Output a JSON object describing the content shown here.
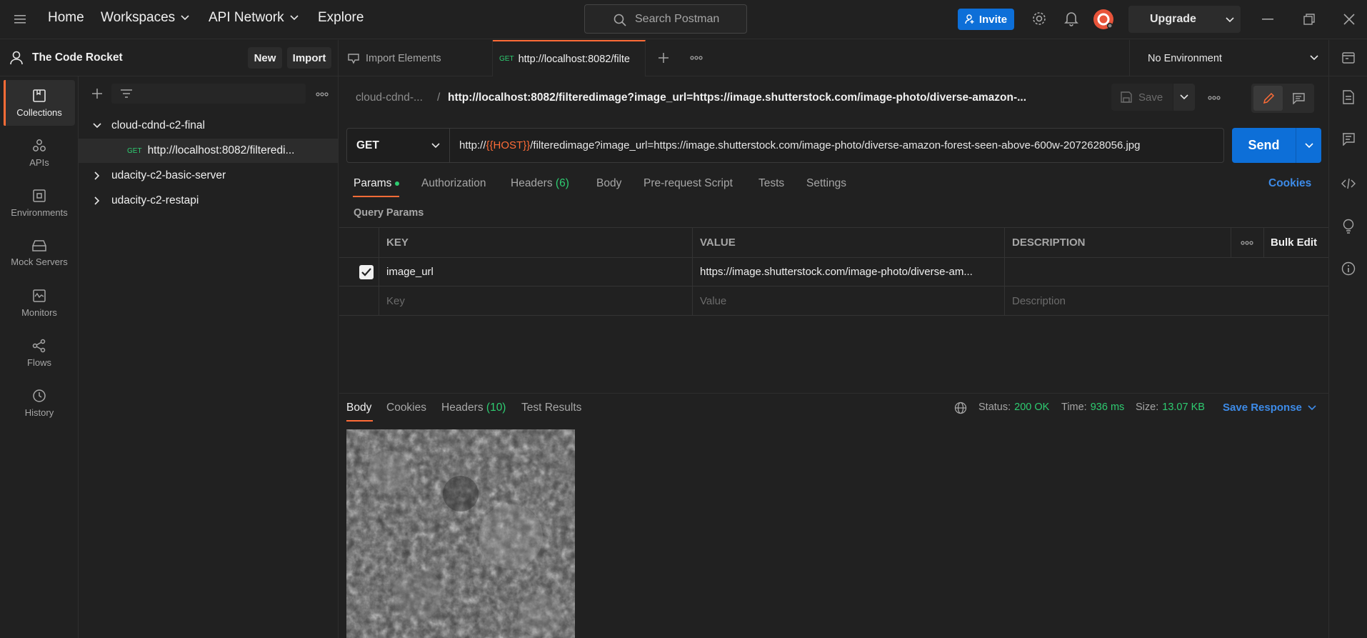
{
  "topbar": {
    "home": "Home",
    "workspaces": "Workspaces",
    "api_network": "API Network",
    "explore": "Explore",
    "search_placeholder": "Search Postman",
    "invite": "Invite",
    "upgrade": "Upgrade"
  },
  "workspace": {
    "name": "The Code Rocket",
    "new_label": "New",
    "import_label": "Import"
  },
  "rail": {
    "items": [
      {
        "label": "Collections",
        "icon": "collections-icon"
      },
      {
        "label": "APIs",
        "icon": "apis-icon"
      },
      {
        "label": "Environments",
        "icon": "environments-icon"
      },
      {
        "label": "Mock Servers",
        "icon": "mock-servers-icon"
      },
      {
        "label": "Monitors",
        "icon": "monitors-icon"
      },
      {
        "label": "Flows",
        "icon": "flows-icon"
      },
      {
        "label": "History",
        "icon": "history-icon"
      }
    ]
  },
  "collections": {
    "tree": [
      {
        "label": "cloud-cdnd-c2-final"
      },
      {
        "method": "GET",
        "label": "http://localhost:8082/filteredi..."
      },
      {
        "label": "udacity-c2-basic-server"
      },
      {
        "label": "udacity-c2-restapi"
      }
    ]
  },
  "tabs": {
    "import_elements": "Import Elements",
    "active_method": "GET",
    "active_label": "http://localhost:8082/filte",
    "environment": "No Environment"
  },
  "request": {
    "breadcrumb_collection": "cloud-cdnd-...",
    "breadcrumb_sep": "/",
    "breadcrumb_title": "http://localhost:8082/filteredimage?image_url=https://image.shutterstock.com/image-photo/diverse-amazon-...",
    "save_label": "Save",
    "method": "GET",
    "url_prefix": "http://",
    "url_variable": "{{HOST}}",
    "url_suffix": "/filteredimage?image_url=https://image.shutterstock.com/image-photo/diverse-amazon-forest-seen-above-600w-2072628056.jpg",
    "send_label": "Send",
    "tabs": {
      "params": "Params",
      "authorization": "Authorization",
      "headers": "Headers",
      "headers_count": "(6)",
      "body": "Body",
      "pre_request": "Pre-request Script",
      "tests": "Tests",
      "settings": "Settings",
      "cookies": "Cookies"
    },
    "query_params_title": "Query Params",
    "table": {
      "col_key": "KEY",
      "col_value": "VALUE",
      "col_description": "DESCRIPTION",
      "bulk_edit": "Bulk Edit",
      "row_key": "image_url",
      "row_value": "https://image.shutterstock.com/image-photo/diverse-am...",
      "key_placeholder": "Key",
      "value_placeholder": "Value",
      "description_placeholder": "Description"
    }
  },
  "response": {
    "tabs": {
      "body": "Body",
      "cookies": "Cookies",
      "headers": "Headers",
      "headers_count": "(10)",
      "test_results": "Test Results"
    },
    "status_label": "Status:",
    "status_value": "200 OK",
    "time_label": "Time:",
    "time_value": "936 ms",
    "size_label": "Size:",
    "size_value": "13.07 KB",
    "save_response": "Save Response"
  },
  "colors": {
    "accent": "#ff6c37",
    "primary_blue": "#0d6fd8",
    "success_green": "#2ecc71",
    "link_blue": "#3d8be8"
  }
}
